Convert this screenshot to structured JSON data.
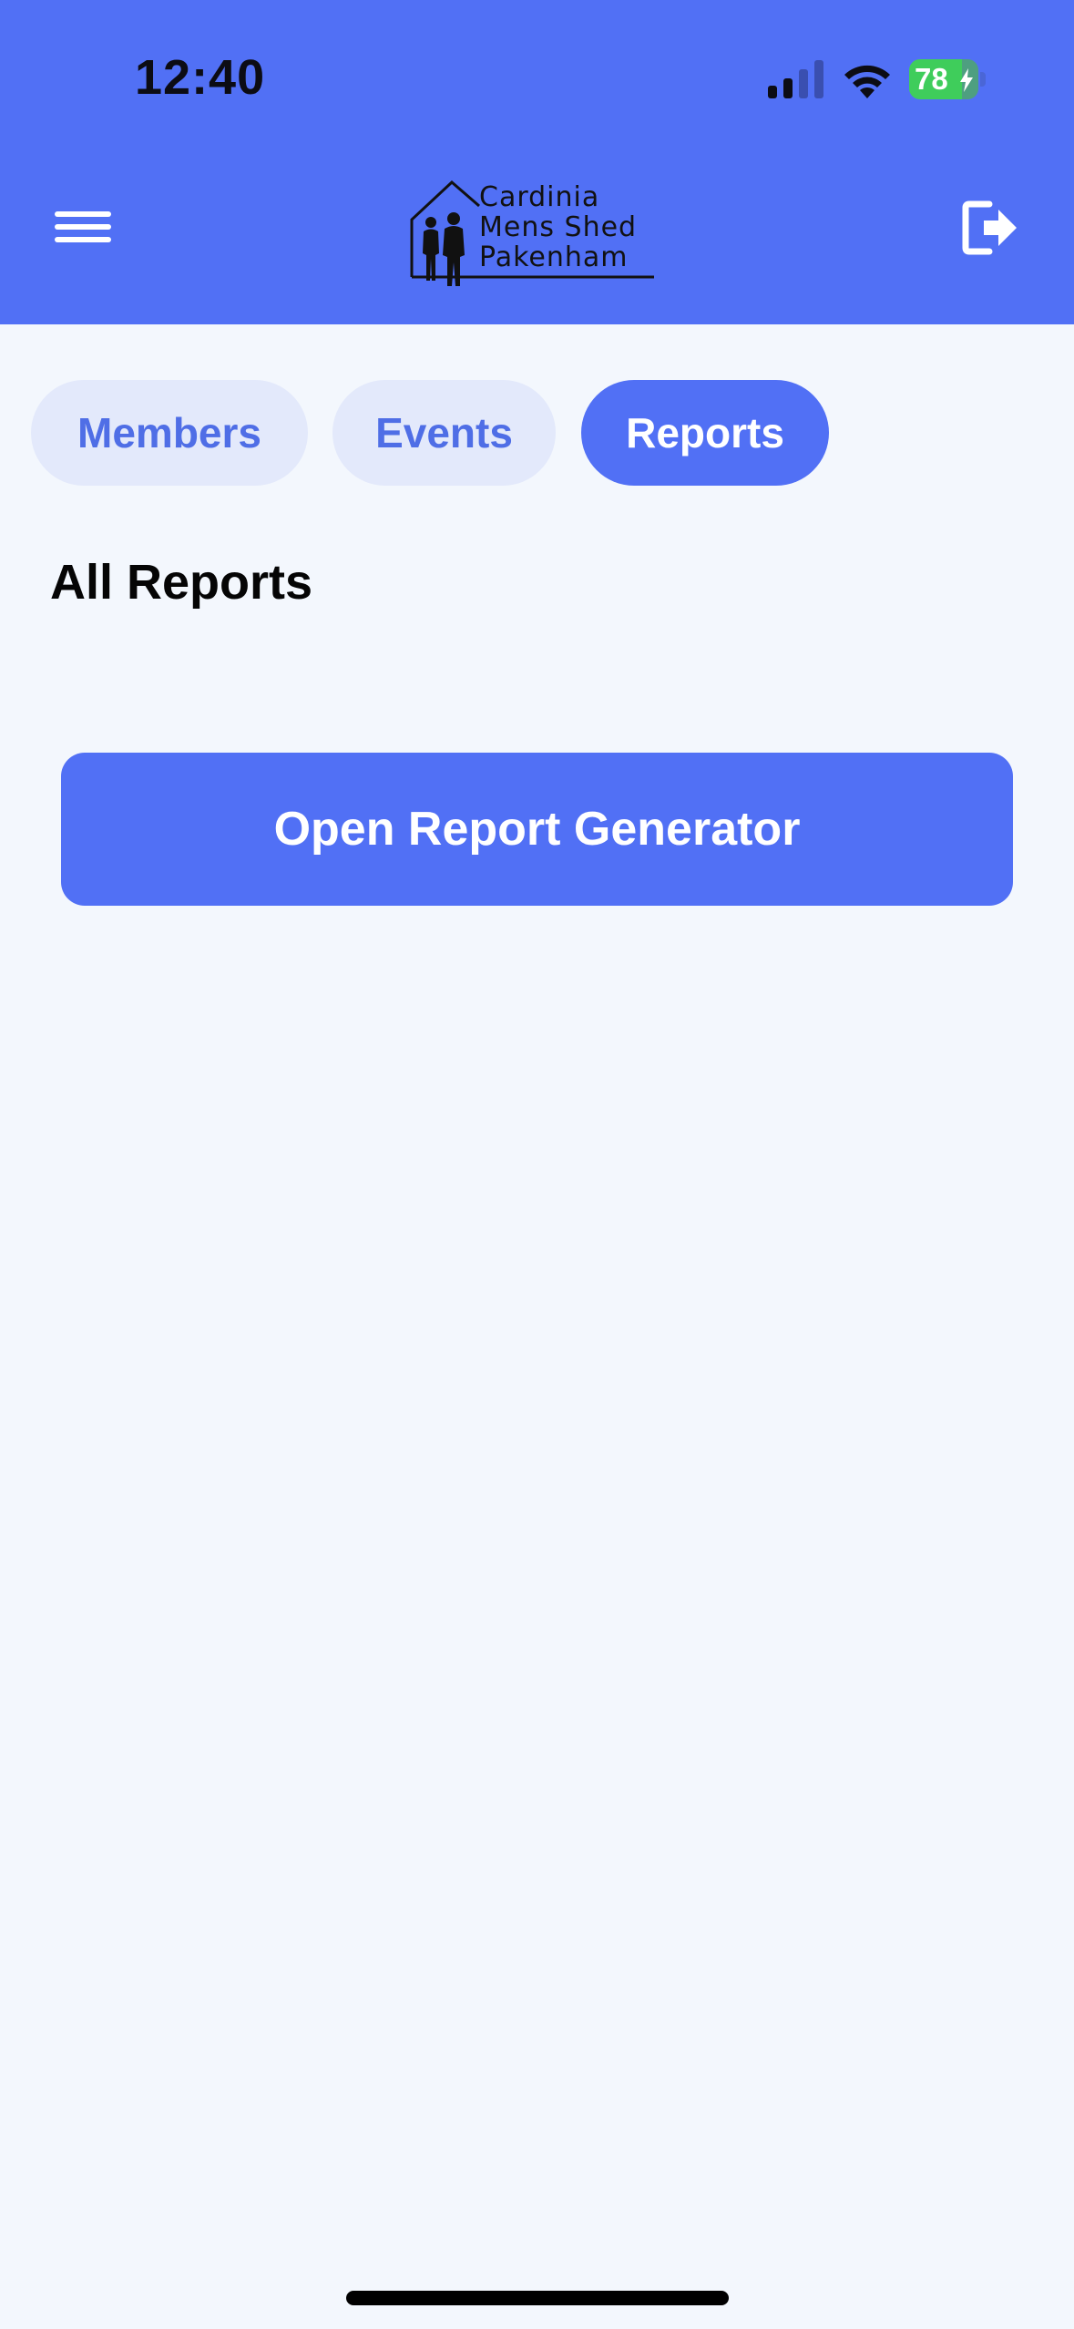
{
  "status_bar": {
    "time": "12:40",
    "battery_level": "78",
    "icons": [
      "signal-icon",
      "wifi-icon",
      "battery-icon",
      "charging-bolt-icon"
    ]
  },
  "header": {
    "logo_lines": [
      "Cardinia",
      "Mens Shed",
      "Pakenham"
    ],
    "menu_icon": "hamburger-menu-icon",
    "logout_icon": "logout-icon",
    "background_color": "#5170f5"
  },
  "tabs": [
    {
      "label": "Members",
      "active": false
    },
    {
      "label": "Events",
      "active": false
    },
    {
      "label": "Reports",
      "active": true
    }
  ],
  "main": {
    "title": "All Reports",
    "primary_button_label": "Open Report Generator"
  },
  "colors": {
    "accent": "#5170f5",
    "tab_inactive_bg": "#e3e9fb",
    "tab_inactive_text": "#4f6ee6",
    "page_bg": "#f3f7fd",
    "battery": "#3fcd5b"
  }
}
